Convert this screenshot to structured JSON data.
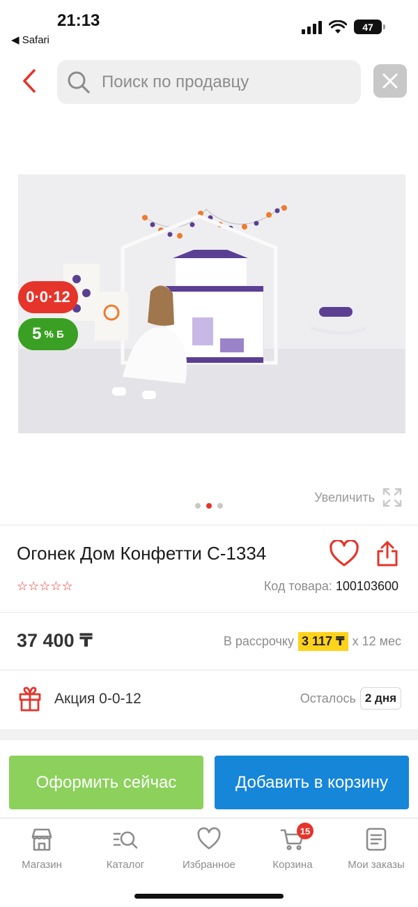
{
  "status_bar": {
    "time": "21:13",
    "back_app": "◀ Safari",
    "battery": "47"
  },
  "search": {
    "placeholder": "Поиск по продавцу"
  },
  "badges": {
    "loan": "0·0·12",
    "bonus_value": "5",
    "bonus_unit": "% Б"
  },
  "gallery": {
    "zoom_label": "Увеличить",
    "current_index": 2,
    "total": 3
  },
  "product": {
    "title": "Огонек Дом Конфетти С-1334",
    "rating_stars": "☆☆☆☆☆",
    "sku_label": "Код товара:",
    "sku_value": "100103600",
    "price": "37 400 ₸",
    "installment_prefix": "В рассрочку",
    "installment_amount": "3 117 ₸",
    "installment_suffix": "х 12 мес"
  },
  "promo": {
    "label": "Акция 0-0-12",
    "remaining_label": "Осталось",
    "remaining_value": "2 дня"
  },
  "actions": {
    "buy_now": "Оформить сейчас",
    "add_to_cart": "Добавить в корзину"
  },
  "nav": {
    "items": [
      {
        "label": "Магазин",
        "icon": "store-icon"
      },
      {
        "label": "Каталог",
        "icon": "catalog-search-icon"
      },
      {
        "label": "Избранное",
        "icon": "heart-icon"
      },
      {
        "label": "Корзина",
        "icon": "cart-icon"
      },
      {
        "label": "Мои заказы",
        "icon": "orders-icon"
      }
    ],
    "cart_count": "15"
  },
  "colors": {
    "accent_red": "#e5352b",
    "green": "#8bd15c",
    "blue": "#1686d9",
    "bonus_green": "#3aa023",
    "highlight_yellow": "#ffd31a"
  }
}
